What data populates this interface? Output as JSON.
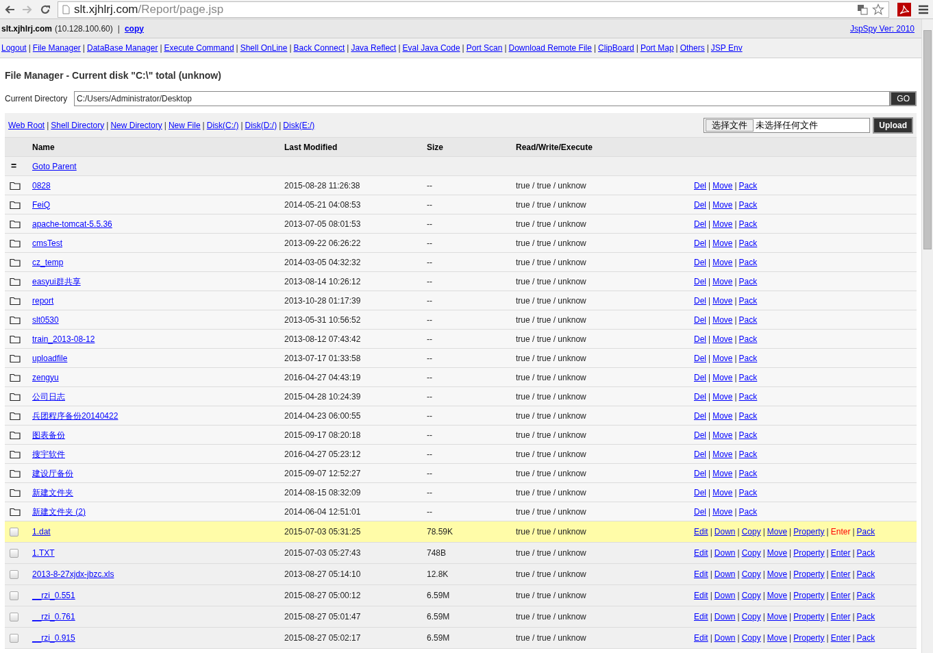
{
  "browser": {
    "url_host": "slt.xjhlrj.com",
    "url_path": "/Report/page.jsp",
    "forward_disabled": true
  },
  "header": {
    "host": "slt.xjhlrj.com",
    "ip": "(10.128.100.60)",
    "sep": "|",
    "copy_link": "copy",
    "version_link": "JspSpy Ver: 2010"
  },
  "nav": [
    "Logout",
    "File Manager",
    "DataBase Manager",
    "Execute Command",
    "Shell OnLine",
    "Back Connect",
    "Java Reflect",
    "Eval Java Code",
    "Port Scan",
    "Download Remote File",
    "ClipBoard",
    "Port Map",
    "Others",
    "JSP Env"
  ],
  "title": "File Manager - Current disk \"C:\\\" total (unknow)",
  "current_directory": {
    "label": "Current Directory",
    "value": "C:/Users/Administrator/Desktop",
    "button": "GO"
  },
  "toolbar": {
    "links": [
      "Web Root",
      "Shell Directory",
      "New Directory",
      "New File",
      "Disk(C:/)",
      "Disk(D:/)",
      "Disk(E:/)"
    ],
    "choose_button": "选择文件",
    "no_file": "未选择任何文件",
    "upload": "Upload"
  },
  "table": {
    "columns": [
      "Name",
      "Last Modified",
      "Size",
      "Read/Write/Execute"
    ],
    "parent": {
      "icon": "=",
      "label": "Goto Parent"
    },
    "rows": [
      {
        "kind": "folder",
        "name": "0828",
        "modified": "2015-08-28 11:26:38",
        "size": "--",
        "rwx": "true / true / unknow",
        "highlighted": false,
        "actions": [
          {
            "label": "Del",
            "hovered": false
          },
          {
            "label": "Move",
            "hovered": false
          },
          {
            "label": "Pack",
            "hovered": false
          }
        ]
      },
      {
        "kind": "folder",
        "name": "FeiQ",
        "modified": "2014-05-21 04:08:53",
        "size": "--",
        "rwx": "true / true / unknow",
        "highlighted": false,
        "actions": [
          {
            "label": "Del",
            "hovered": false
          },
          {
            "label": "Move",
            "hovered": false
          },
          {
            "label": "Pack",
            "hovered": false
          }
        ]
      },
      {
        "kind": "folder",
        "name": "apache-tomcat-5.5.36",
        "modified": "2013-07-05 08:01:53",
        "size": "--",
        "rwx": "true / true / unknow",
        "highlighted": false,
        "actions": [
          {
            "label": "Del",
            "hovered": false
          },
          {
            "label": "Move",
            "hovered": false
          },
          {
            "label": "Pack",
            "hovered": false
          }
        ]
      },
      {
        "kind": "folder",
        "name": "cmsTest",
        "modified": "2013-09-22 06:26:22",
        "size": "--",
        "rwx": "true / true / unknow",
        "highlighted": false,
        "actions": [
          {
            "label": "Del",
            "hovered": false
          },
          {
            "label": "Move",
            "hovered": false
          },
          {
            "label": "Pack",
            "hovered": false
          }
        ]
      },
      {
        "kind": "folder",
        "name": "cz_temp",
        "modified": "2014-03-05 04:32:32",
        "size": "--",
        "rwx": "true / true / unknow",
        "highlighted": false,
        "actions": [
          {
            "label": "Del",
            "hovered": false
          },
          {
            "label": "Move",
            "hovered": false
          },
          {
            "label": "Pack",
            "hovered": false
          }
        ]
      },
      {
        "kind": "folder",
        "name": "easyui群共享",
        "modified": "2013-08-14 10:26:12",
        "size": "--",
        "rwx": "true / true / unknow",
        "highlighted": false,
        "actions": [
          {
            "label": "Del",
            "hovered": false
          },
          {
            "label": "Move",
            "hovered": false
          },
          {
            "label": "Pack",
            "hovered": false
          }
        ]
      },
      {
        "kind": "folder",
        "name": "report",
        "modified": "2013-10-28 01:17:39",
        "size": "--",
        "rwx": "true / true / unknow",
        "highlighted": false,
        "actions": [
          {
            "label": "Del",
            "hovered": false
          },
          {
            "label": "Move",
            "hovered": false
          },
          {
            "label": "Pack",
            "hovered": false
          }
        ]
      },
      {
        "kind": "folder",
        "name": "slt0530",
        "modified": "2013-05-31 10:56:52",
        "size": "--",
        "rwx": "true / true / unknow",
        "highlighted": false,
        "actions": [
          {
            "label": "Del",
            "hovered": false
          },
          {
            "label": "Move",
            "hovered": false
          },
          {
            "label": "Pack",
            "hovered": false
          }
        ]
      },
      {
        "kind": "folder",
        "name": "train_2013-08-12",
        "modified": "2013-08-12 07:43:42",
        "size": "--",
        "rwx": "true / true / unknow",
        "highlighted": false,
        "actions": [
          {
            "label": "Del",
            "hovered": false
          },
          {
            "label": "Move",
            "hovered": false
          },
          {
            "label": "Pack",
            "hovered": false
          }
        ]
      },
      {
        "kind": "folder",
        "name": "uploadfile",
        "modified": "2013-07-17 01:33:58",
        "size": "--",
        "rwx": "true / true / unknow",
        "highlighted": false,
        "actions": [
          {
            "label": "Del",
            "hovered": false
          },
          {
            "label": "Move",
            "hovered": false
          },
          {
            "label": "Pack",
            "hovered": false
          }
        ]
      },
      {
        "kind": "folder",
        "name": "zengyu",
        "modified": "2016-04-27 04:43:19",
        "size": "--",
        "rwx": "true / true / unknow",
        "highlighted": false,
        "actions": [
          {
            "label": "Del",
            "hovered": false
          },
          {
            "label": "Move",
            "hovered": false
          },
          {
            "label": "Pack",
            "hovered": false
          }
        ]
      },
      {
        "kind": "folder",
        "name": "公司日志",
        "modified": "2015-04-28 10:24:39",
        "size": "--",
        "rwx": "true / true / unknow",
        "highlighted": false,
        "actions": [
          {
            "label": "Del",
            "hovered": false
          },
          {
            "label": "Move",
            "hovered": false
          },
          {
            "label": "Pack",
            "hovered": false
          }
        ]
      },
      {
        "kind": "folder",
        "name": "兵团程序备份20140422",
        "modified": "2014-04-23 06:00:55",
        "size": "--",
        "rwx": "true / true / unknow",
        "highlighted": false,
        "actions": [
          {
            "label": "Del",
            "hovered": false
          },
          {
            "label": "Move",
            "hovered": false
          },
          {
            "label": "Pack",
            "hovered": false
          }
        ]
      },
      {
        "kind": "folder",
        "name": "图表备份",
        "modified": "2015-09-17 08:20:18",
        "size": "--",
        "rwx": "true / true / unknow",
        "highlighted": false,
        "actions": [
          {
            "label": "Del",
            "hovered": false
          },
          {
            "label": "Move",
            "hovered": false
          },
          {
            "label": "Pack",
            "hovered": false
          }
        ]
      },
      {
        "kind": "folder",
        "name": "搜宇软件",
        "modified": "2016-04-27 05:23:12",
        "size": "--",
        "rwx": "true / true / unknow",
        "highlighted": false,
        "actions": [
          {
            "label": "Del",
            "hovered": false
          },
          {
            "label": "Move",
            "hovered": false
          },
          {
            "label": "Pack",
            "hovered": false
          }
        ]
      },
      {
        "kind": "folder",
        "name": "建设厅备份",
        "modified": "2015-09-07 12:52:27",
        "size": "--",
        "rwx": "true / true / unknow",
        "highlighted": false,
        "actions": [
          {
            "label": "Del",
            "hovered": false
          },
          {
            "label": "Move",
            "hovered": false
          },
          {
            "label": "Pack",
            "hovered": false
          }
        ]
      },
      {
        "kind": "folder",
        "name": "新建文件夹",
        "modified": "2014-08-15 08:32:09",
        "size": "--",
        "rwx": "true / true / unknow",
        "highlighted": false,
        "actions": [
          {
            "label": "Del",
            "hovered": false
          },
          {
            "label": "Move",
            "hovered": false
          },
          {
            "label": "Pack",
            "hovered": false
          }
        ]
      },
      {
        "kind": "folder",
        "name": "新建文件夹 (2)",
        "modified": "2014-06-04 12:51:01",
        "size": "--",
        "rwx": "true / true / unknow",
        "highlighted": false,
        "actions": [
          {
            "label": "Del",
            "hovered": false
          },
          {
            "label": "Move",
            "hovered": false
          },
          {
            "label": "Pack",
            "hovered": false
          }
        ]
      },
      {
        "kind": "file",
        "name": "1.dat",
        "modified": "2015-07-03 05:31:25",
        "size": "78.59K",
        "rwx": "true / true / unknow",
        "highlighted": true,
        "actions": [
          {
            "label": "Edit",
            "hovered": false
          },
          {
            "label": "Down",
            "hovered": false
          },
          {
            "label": "Copy",
            "hovered": false
          },
          {
            "label": "Move",
            "hovered": false
          },
          {
            "label": "Property",
            "hovered": false
          },
          {
            "label": "Enter",
            "hovered": true
          },
          {
            "label": "Pack",
            "hovered": false
          }
        ]
      },
      {
        "kind": "file",
        "name": "1.TXT",
        "modified": "2015-07-03 05:27:43",
        "size": "748B",
        "rwx": "true / true / unknow",
        "highlighted": false,
        "actions": [
          {
            "label": "Edit",
            "hovered": false
          },
          {
            "label": "Down",
            "hovered": false
          },
          {
            "label": "Copy",
            "hovered": false
          },
          {
            "label": "Move",
            "hovered": false
          },
          {
            "label": "Property",
            "hovered": false
          },
          {
            "label": "Enter",
            "hovered": false
          },
          {
            "label": "Pack",
            "hovered": false
          }
        ]
      },
      {
        "kind": "file",
        "name": "2013-8-27xjdx-jbzc.xls",
        "modified": "2013-08-27 05:14:10",
        "size": "12.8K",
        "rwx": "true / true / unknow",
        "highlighted": false,
        "actions": [
          {
            "label": "Edit",
            "hovered": false
          },
          {
            "label": "Down",
            "hovered": false
          },
          {
            "label": "Copy",
            "hovered": false
          },
          {
            "label": "Move",
            "hovered": false
          },
          {
            "label": "Property",
            "hovered": false
          },
          {
            "label": "Enter",
            "hovered": false
          },
          {
            "label": "Pack",
            "hovered": false
          }
        ]
      },
      {
        "kind": "file",
        "name": "__rzi_0.551",
        "modified": "2015-08-27 05:00:12",
        "size": "6.59M",
        "rwx": "true / true / unknow",
        "highlighted": false,
        "actions": [
          {
            "label": "Edit",
            "hovered": false
          },
          {
            "label": "Down",
            "hovered": false
          },
          {
            "label": "Copy",
            "hovered": false
          },
          {
            "label": "Move",
            "hovered": false
          },
          {
            "label": "Property",
            "hovered": false
          },
          {
            "label": "Enter",
            "hovered": false
          },
          {
            "label": "Pack",
            "hovered": false
          }
        ]
      },
      {
        "kind": "file",
        "name": "__rzi_0.761",
        "modified": "2015-08-27 05:01:47",
        "size": "6.59M",
        "rwx": "true / true / unknow",
        "highlighted": false,
        "actions": [
          {
            "label": "Edit",
            "hovered": false
          },
          {
            "label": "Down",
            "hovered": false
          },
          {
            "label": "Copy",
            "hovered": false
          },
          {
            "label": "Move",
            "hovered": false
          },
          {
            "label": "Property",
            "hovered": false
          },
          {
            "label": "Enter",
            "hovered": false
          },
          {
            "label": "Pack",
            "hovered": false
          }
        ]
      },
      {
        "kind": "file",
        "name": "__rzi_0.915",
        "modified": "2015-08-27 05:02:17",
        "size": "6.59M",
        "rwx": "true / true / unknow",
        "highlighted": false,
        "actions": [
          {
            "label": "Edit",
            "hovered": false
          },
          {
            "label": "Down",
            "hovered": false
          },
          {
            "label": "Copy",
            "hovered": false
          },
          {
            "label": "Move",
            "hovered": false
          },
          {
            "label": "Property",
            "hovered": false
          },
          {
            "label": "Enter",
            "hovered": false
          },
          {
            "label": "Pack",
            "hovered": false
          }
        ]
      }
    ]
  }
}
